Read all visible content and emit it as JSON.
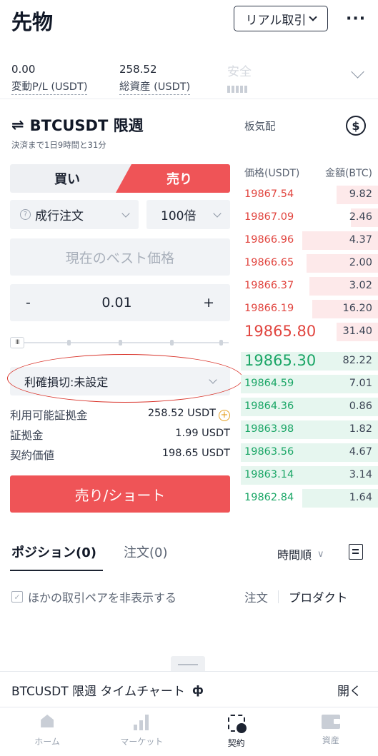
{
  "header": {
    "title": "先物",
    "mode_label": "リアル取引",
    "more_label": "···"
  },
  "stats": {
    "pnl_value": "0.00",
    "pnl_label": "変動P/L (USDT)",
    "assets_value": "258.52",
    "assets_label": "総資産 (USDT)",
    "safety_label": "安全"
  },
  "pair": {
    "arrows": "⇌",
    "name": "BTCUSDT 限週",
    "settle_note": "決済まで1日9時間と31分"
  },
  "orderbook": {
    "label": "板気配",
    "price_header": "価格(USDT)",
    "amount_header": "金額(BTC)",
    "asks": [
      {
        "price": "19867.54",
        "amount": "9.82",
        "depth": 0.3
      },
      {
        "price": "19867.09",
        "amount": "2.46",
        "depth": 0.2
      },
      {
        "price": "19866.96",
        "amount": "4.37",
        "depth": 0.55
      },
      {
        "price": "19866.65",
        "amount": "2.00",
        "depth": 0.52
      },
      {
        "price": "19866.37",
        "amount": "3.02",
        "depth": 0.5
      },
      {
        "price": "19866.19",
        "amount": "16.20",
        "depth": 0.48
      },
      {
        "price": "19865.80",
        "amount": "31.40",
        "depth": 0.3
      }
    ],
    "bids": [
      {
        "price": "19865.30",
        "amount": "82.22",
        "depth": 1.0
      },
      {
        "price": "19864.59",
        "amount": "7.01",
        "depth": 1.0
      },
      {
        "price": "19864.36",
        "amount": "0.86",
        "depth": 1.0
      },
      {
        "price": "19863.98",
        "amount": "1.82",
        "depth": 1.0
      },
      {
        "price": "19863.56",
        "amount": "4.67",
        "depth": 1.0
      },
      {
        "price": "19863.14",
        "amount": "3.14",
        "depth": 1.0
      },
      {
        "price": "19862.84",
        "amount": "1.64",
        "depth": 0.55
      }
    ]
  },
  "form": {
    "buy_label": "買い",
    "sell_label": "売り",
    "order_type": "成行注文",
    "help_glyph": "?",
    "leverage": "100倍",
    "price_placeholder": "現在のベスト価格",
    "qty_minus": "-",
    "qty_value": "0.01",
    "qty_plus": "+",
    "slider_handle": "III",
    "tpsl_label": "利確損切:未設定",
    "available_label": "利用可能証拠金",
    "available_value": "258.52 USDT",
    "plus_glyph": "+",
    "margin_label": "証拠金",
    "margin_value": "1.99 USDT",
    "contract_label": "契約価値",
    "contract_value": "198.65 USDT",
    "submit_label": "売り/ショート"
  },
  "positions": {
    "tab_positions": "ポジション(0)",
    "tab_orders": "注文(0)",
    "sort_label": "時間順",
    "sort_glyph": "∨",
    "hide_pairs_label": "ほかの取引ペアを非表示する",
    "check_glyph": "✓",
    "link_order": "注文",
    "link_product": "プロダクト"
  },
  "chart_bar": {
    "title": "BTCUSDT 限週 タイムチャート",
    "candle_glyph": "ф",
    "open_label": "開く"
  },
  "nav": {
    "home": "ホーム",
    "market": "マーケット",
    "contract": "契約",
    "assets": "資産"
  }
}
